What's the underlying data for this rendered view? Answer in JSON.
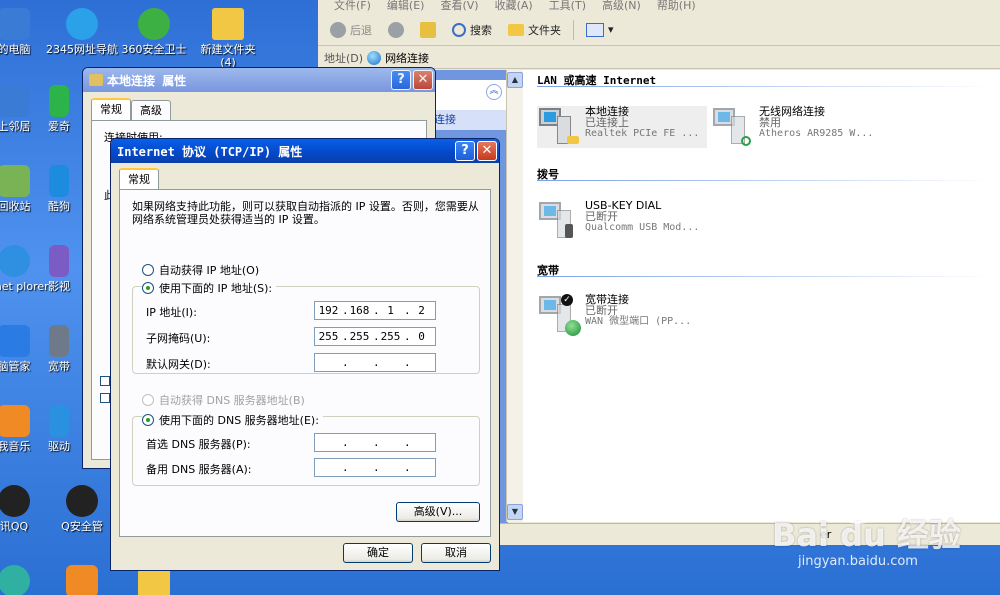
{
  "desktop": {
    "icons": [
      {
        "label": "的电脑",
        "color": "#3a7bd5"
      },
      {
        "label": "2345网址导航",
        "color": "#2aa1e8"
      },
      {
        "label": "360安全卫士",
        "color": "#3cb043"
      },
      {
        "label": "新建文件夹 (4)",
        "color": "#f2c744"
      },
      {
        "label": "上邻居",
        "color": "#3a7bd5"
      },
      {
        "label": "爱奇",
        "color": "#2cb34a"
      },
      {
        "label": "回收站",
        "color": "#7ab356"
      },
      {
        "label": "酷狗",
        "color": "#1d8be0"
      },
      {
        "label": "ternet plorer",
        "color": "#2f8fe0"
      },
      {
        "label": "影视",
        "color": "#7a5cc4"
      },
      {
        "label": "脑管家",
        "color": "#2a7be4"
      },
      {
        "label": "宽带",
        "color": "#6e7a8a"
      },
      {
        "label": "我音乐",
        "color": "#f08a24"
      },
      {
        "label": "驱动",
        "color": "#2a90e0"
      },
      {
        "label": "讯QQ",
        "color": "#222222"
      },
      {
        "label": "Q安全管",
        "color": "#222222"
      }
    ]
  },
  "explorer": {
    "menu": [
      "文件(F)",
      "编辑(E)",
      "查看(V)",
      "收藏(A)",
      "工具(T)",
      "高级(N)",
      "帮助(H)"
    ],
    "toolbar": {
      "back": "后退",
      "search": "搜索",
      "folders": "文件夹"
    },
    "address": {
      "label": "地址(D)",
      "value": "网络连接"
    },
    "taskpane_link": "连接",
    "groups": {
      "lan": "LAN 或高速 Internet",
      "dialup": "拨号",
      "broadband": "宽带"
    },
    "items": [
      {
        "name": "本地连接",
        "status": "已连接上",
        "device": "Realtek PCIe FE ..."
      },
      {
        "name": "无线网络连接",
        "status": "禁用",
        "device": "Atheros AR9285 W..."
      },
      {
        "name": "USB-KEY DIAL",
        "status": "已断开",
        "device": "Qualcomm USB Mod..."
      },
      {
        "name": "宽带连接",
        "status": "已断开",
        "device": "WAN 微型端口 (PP..."
      }
    ],
    "status_text": "er"
  },
  "local_dialog": {
    "title": "本地连接 属性",
    "tabs": [
      "常规",
      "高级"
    ],
    "connect_using": "连接时使用:",
    "fragment": "此"
  },
  "tcpip_dialog": {
    "title": "Internet 协议 (TCP/IP) 属性",
    "tab": "常规",
    "intro": "如果网络支持此功能，则可以获取自动指派的 IP 设置。否则，您需要从网络系统管理员处获得适当的 IP 设置。",
    "auto_ip": "自动获得 IP 地址(O)",
    "manual_ip": "使用下面的 IP 地址(S):",
    "ip_label": "IP 地址(I):",
    "ip_value": [
      "192",
      "168",
      "1",
      "2"
    ],
    "mask_label": "子网掩码(U):",
    "mask_value": [
      "255",
      "255",
      "255",
      "0"
    ],
    "gateway_label": "默认网关(D):",
    "auto_dns": "自动获得 DNS 服务器地址(B)",
    "manual_dns": "使用下面的 DNS 服务器地址(E):",
    "dns1_label": "首选 DNS 服务器(P):",
    "dns2_label": "备用 DNS 服务器(A):",
    "advanced_btn": "高级(V)...",
    "ok_btn": "确定",
    "cancel_btn": "取消"
  },
  "watermark": {
    "brand": "Bai du 经验",
    "url": "jingyan.baidu.com"
  }
}
